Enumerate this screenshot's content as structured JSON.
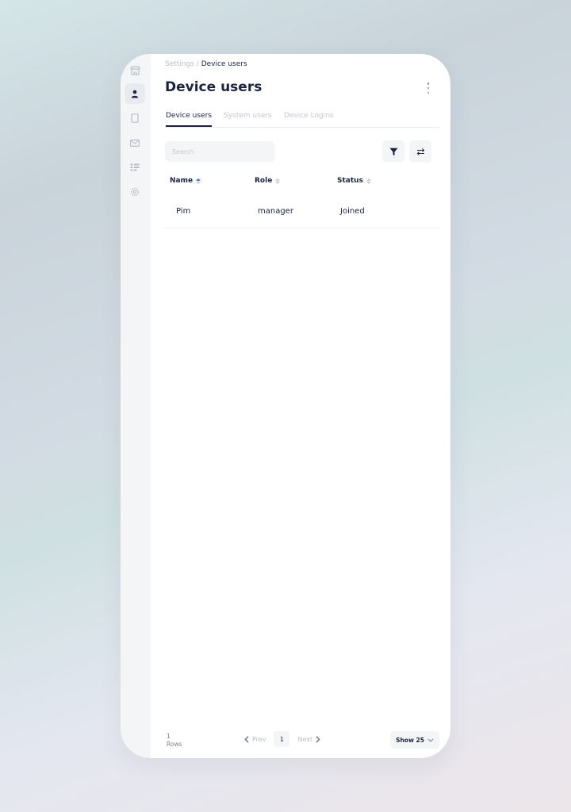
{
  "breadcrumb": {
    "parent": "Settings",
    "separator": " / ",
    "current": "Device users"
  },
  "page": {
    "title": "Device users"
  },
  "sidebar": {
    "items": [
      {
        "icon": "store-icon",
        "active": false
      },
      {
        "icon": "user-icon",
        "active": true
      },
      {
        "icon": "tablet-icon",
        "active": false
      },
      {
        "icon": "mail-icon",
        "active": false
      },
      {
        "icon": "grid-list-icon",
        "active": false
      },
      {
        "icon": "gear-icon",
        "active": false
      }
    ]
  },
  "tabs": [
    {
      "label": "Device users",
      "active": true
    },
    {
      "label": "System users",
      "active": false
    },
    {
      "label": "Device Logins",
      "active": false
    }
  ],
  "search": {
    "placeholder": "Search",
    "value": ""
  },
  "toolbar": {
    "filter_icon": "filter-icon",
    "swap_icon": "swap-arrows-icon"
  },
  "table": {
    "columns": [
      "Name",
      "Role",
      "Status"
    ],
    "rows": [
      {
        "name": "Pim",
        "role": "manager",
        "status": "Joined"
      }
    ]
  },
  "footer": {
    "row_count": "1",
    "rows_label": "Rows",
    "prev_label": "Prev",
    "next_label": "Next",
    "current_page": "1",
    "show_label": "Show 25"
  },
  "colors": {
    "primary": "#1c2340",
    "muted": "#b9bdc7",
    "surface": "#f4f5f7",
    "sort_active": "#3a6fd8"
  }
}
